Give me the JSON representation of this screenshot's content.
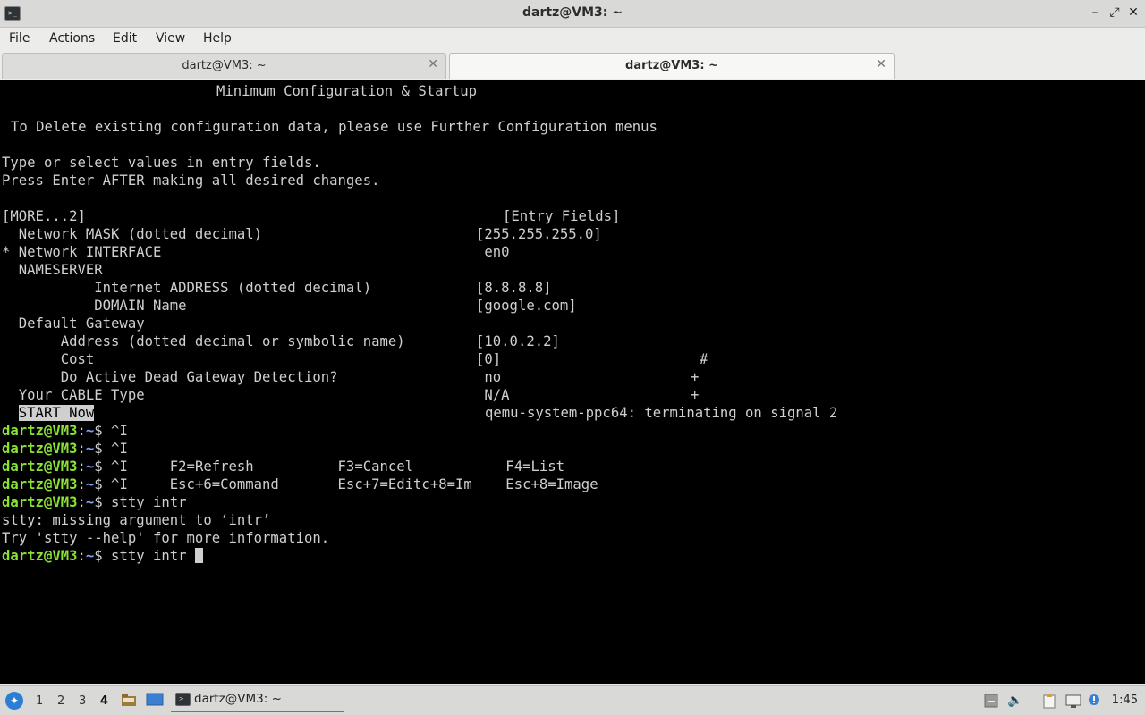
{
  "window": {
    "title": "dartz@VM3: ~"
  },
  "menu": [
    "File",
    "Actions",
    "Edit",
    "View",
    "Help"
  ],
  "tabs": [
    {
      "label": "dartz@VM3: ~",
      "active": false
    },
    {
      "label": "dartz@VM3: ~",
      "active": true
    }
  ],
  "terminal": {
    "screen": {
      "title": "Minimum Configuration & Startup",
      "delete_note": "To Delete existing configuration data, please use Further Configuration menus",
      "instructions": [
        "Type or select values in entry fields.",
        "Press Enter AFTER making all desired changes."
      ],
      "more_marker": "[MORE...2]",
      "entry_fields_header": "[Entry Fields]",
      "fields": [
        {
          "label": "  Network MASK (dotted decimal)",
          "value": "[255.255.255.0]",
          "suffix": ""
        },
        {
          "label": "* Network INTERFACE",
          "value": " en0",
          "suffix": ""
        },
        {
          "label": "  NAMESERVER",
          "value": "",
          "suffix": ""
        },
        {
          "label": "           Internet ADDRESS (dotted decimal)",
          "value": "[8.8.8.8]",
          "suffix": ""
        },
        {
          "label": "           DOMAIN Name",
          "value": "[google.com]",
          "suffix": ""
        },
        {
          "label": "  Default Gateway",
          "value": "",
          "suffix": ""
        },
        {
          "label": "       Address (dotted decimal or symbolic name)",
          "value": "[10.0.2.2]",
          "suffix": ""
        },
        {
          "label": "       Cost",
          "value": "[0]",
          "suffix": "#"
        },
        {
          "label": "       Do Active Dead Gateway Detection?",
          "value": " no",
          "suffix": "+"
        },
        {
          "label": "  Your CABLE Type",
          "value": " N/A",
          "suffix": "+"
        }
      ],
      "start_now": "START Now",
      "termination": "qemu-system-ppc64: terminating on signal 2"
    },
    "prompt": {
      "user_host": "dartz@VM3",
      "path": "~",
      "sigil": "$"
    },
    "history": [
      {
        "type": "cmd",
        "text": " ^I"
      },
      {
        "type": "cmd",
        "text": " ^I"
      },
      {
        "type": "cmd",
        "text": " ^I     F2=Refresh          F3=Cancel           F4=List"
      },
      {
        "type": "cmd",
        "text": " ^I     Esc+6=Command       Esc+7=Editc+8=Im    Esc+8=Image"
      },
      {
        "type": "cmd",
        "text": " stty intr"
      },
      {
        "type": "out",
        "text": "stty: missing argument to ‘intr’"
      },
      {
        "type": "out",
        "text": "Try 'stty --help' for more information."
      },
      {
        "type": "cmd",
        "text": " stty intr "
      }
    ]
  },
  "taskbar": {
    "workspaces": [
      "1",
      "2",
      "3",
      "4"
    ],
    "active_workspace": "4",
    "task_label": "dartz@VM3: ~",
    "clock": "1:45"
  },
  "colors": {
    "prompt_user": "#8ae234",
    "prompt_path": "#7ea0ff",
    "terminal_bg": "#000000",
    "terminal_fg": "#cfcfcf"
  }
}
